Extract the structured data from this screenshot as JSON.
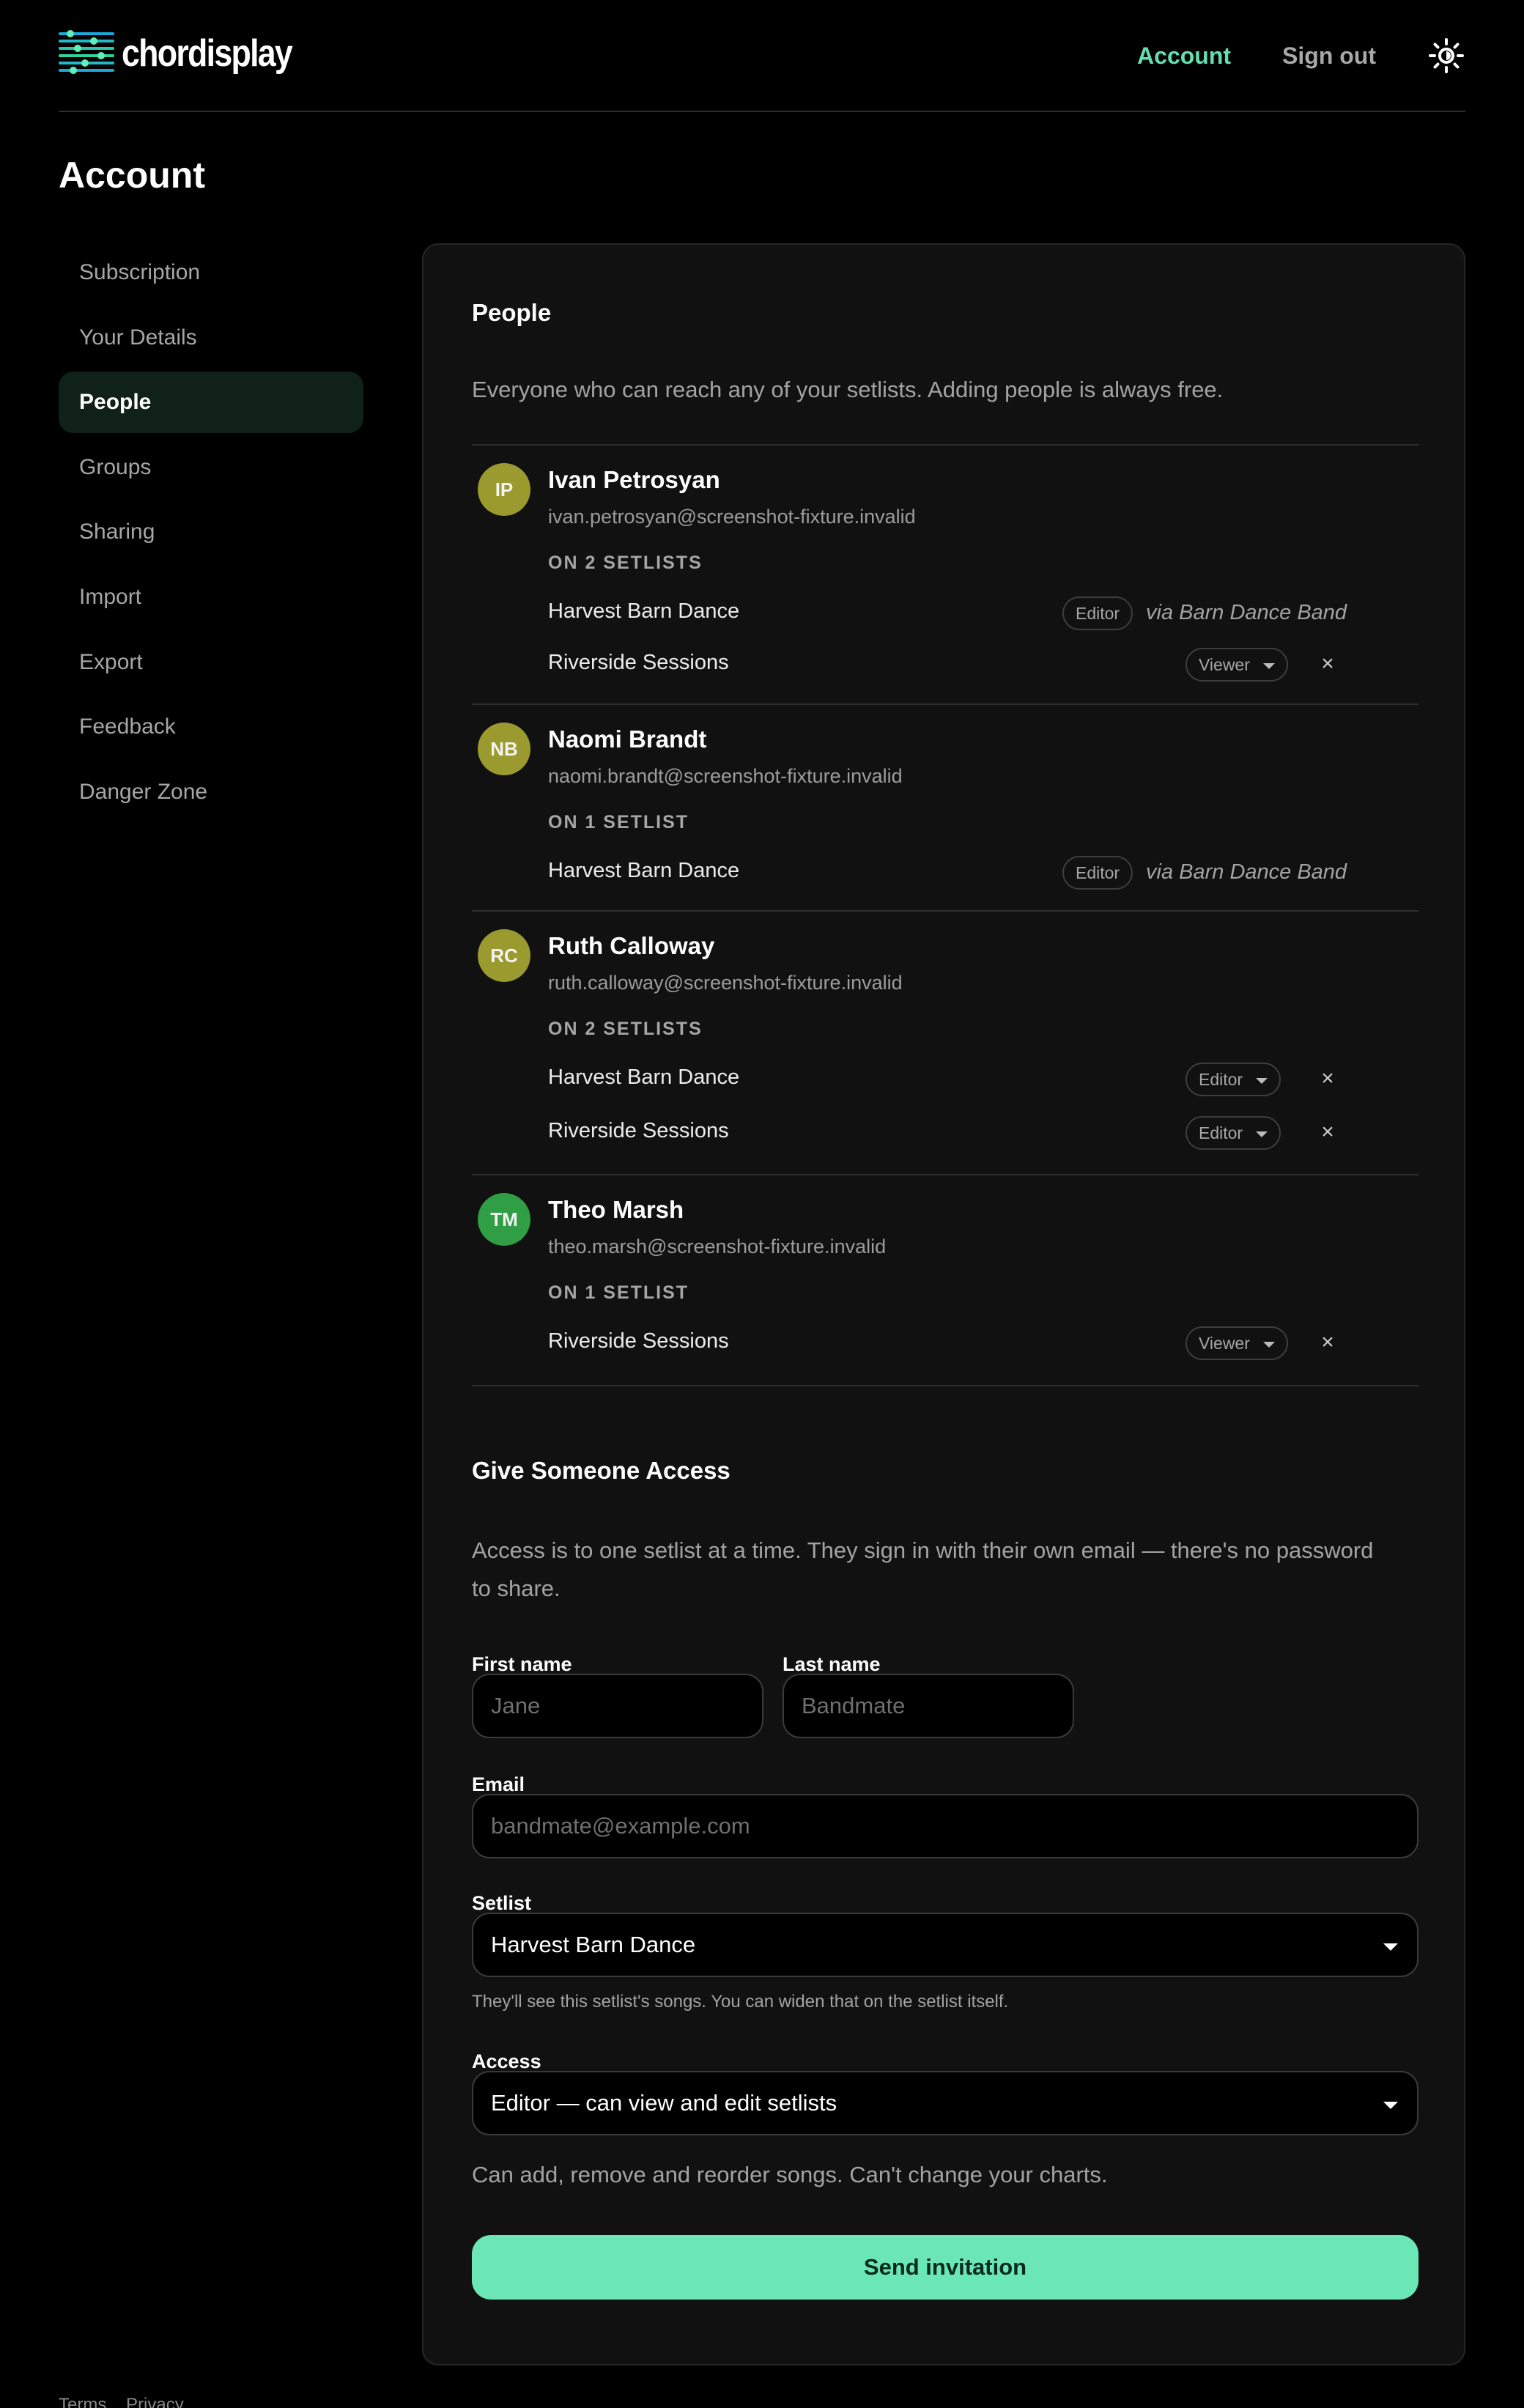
{
  "brand": {
    "name": "chordisplay"
  },
  "nav": {
    "account": "Account",
    "signout": "Sign out"
  },
  "page": {
    "title": "Account"
  },
  "sidebar": {
    "items": [
      {
        "label": "Subscription"
      },
      {
        "label": "Your Details"
      },
      {
        "label": "People"
      },
      {
        "label": "Groups"
      },
      {
        "label": "Sharing"
      },
      {
        "label": "Import"
      },
      {
        "label": "Export"
      },
      {
        "label": "Feedback"
      },
      {
        "label": "Danger Zone"
      }
    ],
    "active": "People"
  },
  "people": {
    "title": "People",
    "intro": "Everyone who can reach any of your setlists. Adding people is always free.",
    "list": [
      {
        "initials": "IP",
        "avatar_color": "#9a9a2e",
        "name": "Ivan Petrosyan",
        "email": "ivan.petrosyan@screenshot-fixture.invalid",
        "count": "ON 2 SETLISTS",
        "setlists": [
          {
            "name": "Harvest Barn Dance",
            "role": "Editor",
            "via": "via Barn Dance Band"
          },
          {
            "name": "Riverside Sessions",
            "role": "Viewer",
            "remove": "×"
          }
        ]
      },
      {
        "initials": "NB",
        "avatar_color": "#9a9a2e",
        "name": "Naomi Brandt",
        "email": "naomi.brandt@screenshot-fixture.invalid",
        "count": "ON 1 SETLIST",
        "setlists": [
          {
            "name": "Harvest Barn Dance",
            "role": "Editor",
            "via": "via Barn Dance Band"
          }
        ]
      },
      {
        "initials": "RC",
        "avatar_color": "#9a9a2e",
        "name": "Ruth Calloway",
        "email": "ruth.calloway@screenshot-fixture.invalid",
        "count": "ON 2 SETLISTS",
        "setlists": [
          {
            "name": "Harvest Barn Dance",
            "role": "Editor",
            "remove": "×"
          },
          {
            "name": "Riverside Sessions",
            "role": "Editor",
            "remove": "×"
          }
        ]
      },
      {
        "initials": "TM",
        "avatar_color": "#2f9e44",
        "name": "Theo Marsh",
        "email": "theo.marsh@screenshot-fixture.invalid",
        "count": "ON 1 SETLIST",
        "setlists": [
          {
            "name": "Riverside Sessions",
            "role": "Viewer",
            "remove": "×"
          }
        ]
      }
    ]
  },
  "invite": {
    "title": "Give Someone Access",
    "intro_line1": "Access is to one setlist at a time. They sign in with their own email — there's no password",
    "intro_line2": "to share.",
    "first_label": "First name",
    "first_placeholder": "Jane",
    "last_label": "Last name",
    "last_placeholder": "Bandmate",
    "email_label": "Email",
    "email_placeholder": "bandmate@example.com",
    "setlist_label": "Setlist",
    "setlist_value": "Harvest Barn Dance",
    "setlist_hint": "They'll see this setlist's songs. You can widen that on the setlist itself.",
    "access_label": "Access",
    "access_value": "Editor — can view and edit setlists",
    "access_desc": "Can add, remove and reorder songs. Can't change your charts.",
    "submit": "Send invitation"
  },
  "footer": {
    "terms": "Terms",
    "privacy": "Privacy"
  },
  "colors": {
    "accent": "#62e0b0",
    "button": "#6be6b6",
    "background": "#000000",
    "card": "#111111"
  },
  "icons": {
    "logo": "equalizer-logo-icon",
    "theme": "sun-icon",
    "remove": "close-icon",
    "dropdown": "chevron-down-icon"
  }
}
